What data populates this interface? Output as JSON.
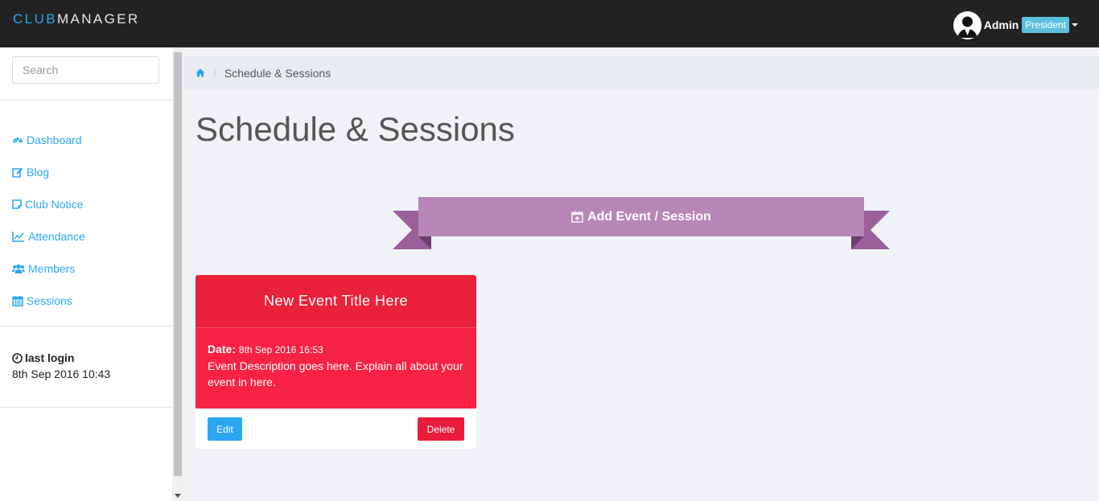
{
  "header": {
    "brand_part1": "CLUB",
    "brand_part2": "MANAGER",
    "user_name": "Admin",
    "user_role": "President"
  },
  "sidebar": {
    "search_placeholder": "Search",
    "items": [
      {
        "label": "Dashboard",
        "icon": "dashboard-icon"
      },
      {
        "label": "Blog",
        "icon": "edit-icon"
      },
      {
        "label": "Club Notice",
        "icon": "sticky-note-icon"
      },
      {
        "label": "Attendance",
        "icon": "line-chart-icon"
      },
      {
        "label": "Members",
        "icon": "users-icon"
      },
      {
        "label": "Sessions",
        "icon": "calendar-icon"
      }
    ],
    "last_login_label": "last login",
    "last_login_time": "8th Sep 2016 10:43"
  },
  "breadcrumb": {
    "home_icon": "home-icon",
    "current": "Schedule & Sessions"
  },
  "main": {
    "title": "Schedule & Sessions",
    "add_button_label": "Add Event / Session"
  },
  "event": {
    "title": "New Event Title Here",
    "date_label": "Date:",
    "date_value": "8th Sep 2016 16:53",
    "description": "Event Description goes here. Explain all about your event in here.",
    "edit_label": "Edit",
    "delete_label": "Delete"
  },
  "colors": {
    "topbar": "#222222",
    "accent": "#2ba6f0",
    "ribbon": "#b886b8",
    "card_header": "#eb2039",
    "card_body": "#f82244",
    "badge": "#5bc0de"
  }
}
